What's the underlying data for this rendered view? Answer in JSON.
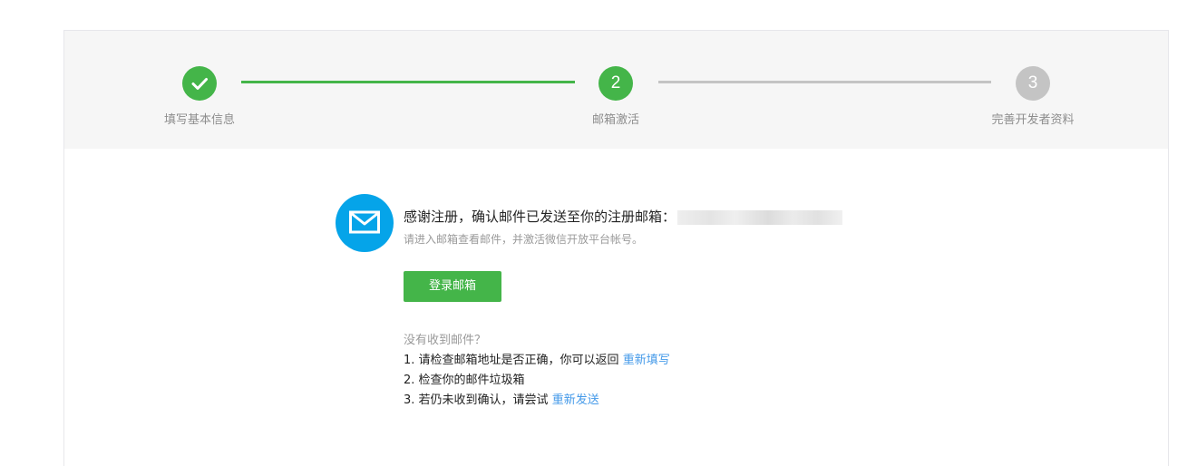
{
  "steps": [
    {
      "label": "填写基本信息",
      "state": "done",
      "icon": "check-icon"
    },
    {
      "label": "邮箱激活",
      "state": "active",
      "number": "2"
    },
    {
      "label": "完善开发者资料",
      "state": "todo",
      "number": "3"
    }
  ],
  "message": {
    "icon": "mail-icon",
    "title": "感谢注册，确认邮件已发送至你的注册邮箱：",
    "subtitle": "请进入邮箱查看邮件，并激活微信开放平台帐号。"
  },
  "login_button": "登录邮箱",
  "help": {
    "question": "没有收到邮件？",
    "item1_text": "1. 请检查邮箱地址是否正确，你可以返回",
    "item1_link": "重新填写",
    "item2_text": "2. 检查你的邮件垃圾箱",
    "item3_text": "3. 若仍未收到确认，请尝试",
    "item3_link": "重新发送"
  },
  "colors": {
    "green": "#44b549",
    "gray": "#c4c4c4",
    "blue_icon": "#05a4e9",
    "link": "#459ae9"
  }
}
